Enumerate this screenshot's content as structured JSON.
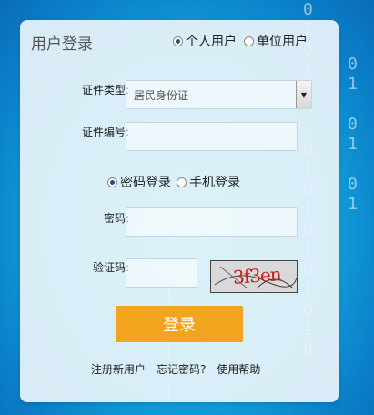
{
  "header": {
    "title": "用户登录"
  },
  "user_types": [
    {
      "label": "个人用户",
      "checked": true
    },
    {
      "label": "单位用户",
      "checked": false
    }
  ],
  "form": {
    "id_type": {
      "label": "证件类型:",
      "value": "居民身份证"
    },
    "id_number": {
      "label": "证件编号:",
      "value": ""
    },
    "login_modes": [
      {
        "label": "密码登录",
        "checked": true
      },
      {
        "label": "手机登录",
        "checked": false
      }
    ],
    "password": {
      "label": "密码:",
      "value": ""
    },
    "captcha": {
      "label": "验证码:",
      "value": "",
      "image_text": "3f3en"
    }
  },
  "submit_label": "登录",
  "links": {
    "register": "注册新用户",
    "forgot": "忘记密码?",
    "help": "使用帮助"
  },
  "colors": {
    "accent": "#f2a41e",
    "background": "#13a9e0"
  }
}
